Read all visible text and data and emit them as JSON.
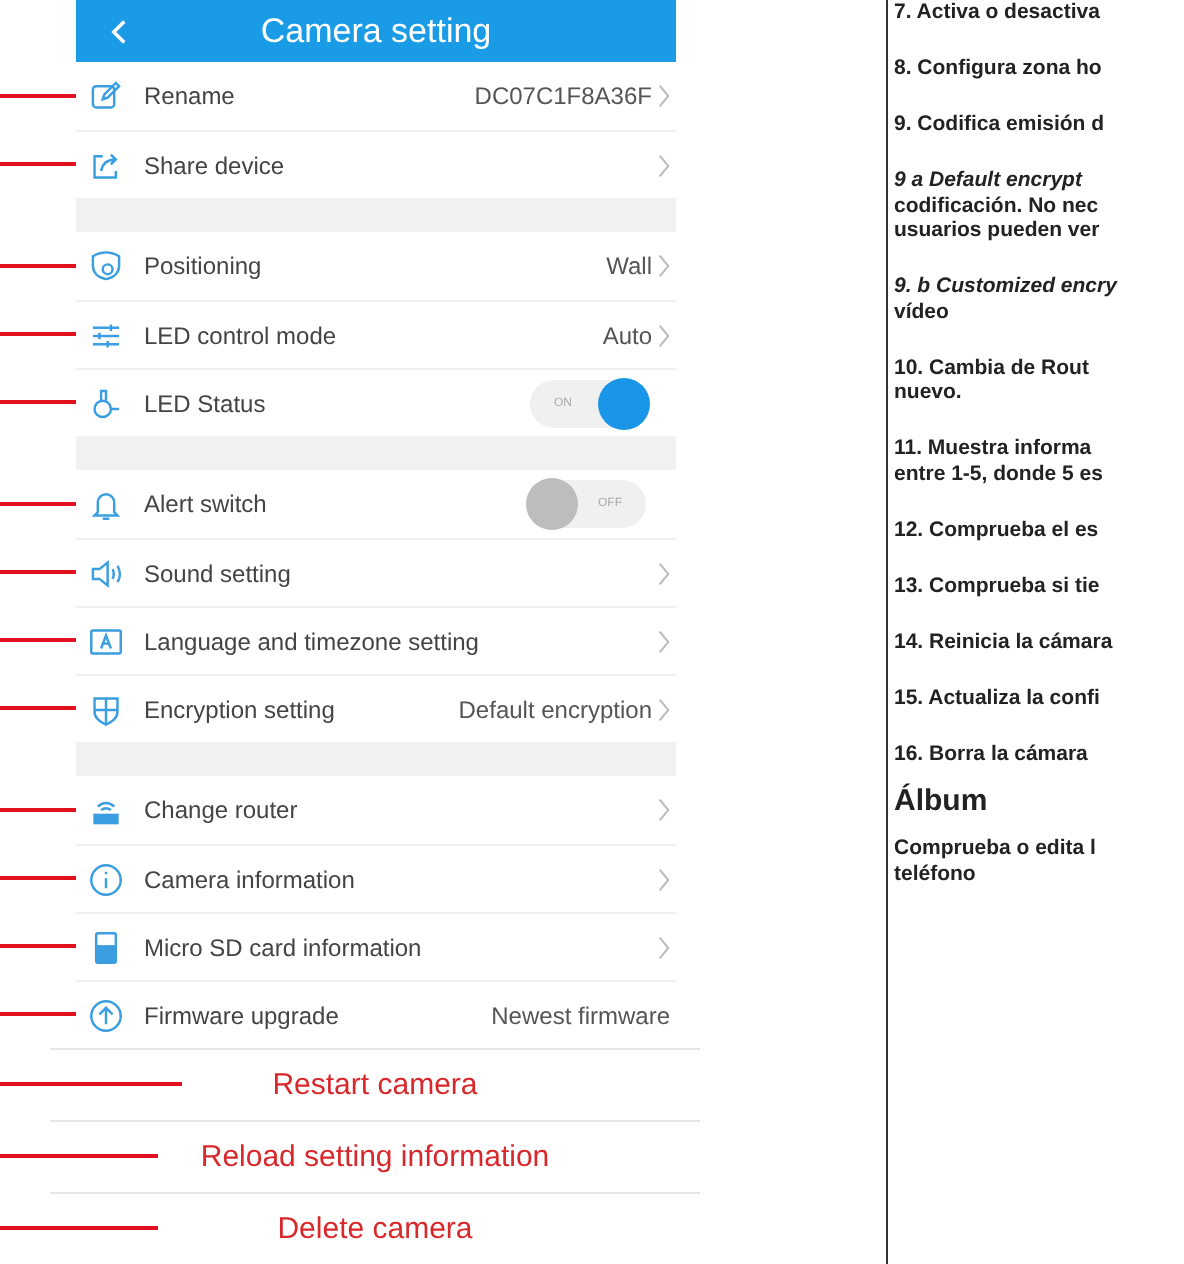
{
  "header": {
    "title": "Camera setting"
  },
  "groups": [
    [
      {
        "kind": "link",
        "label": "Rename",
        "value": "DC07C1F8A36F"
      },
      {
        "kind": "link",
        "label": "Share device"
      }
    ],
    [
      {
        "kind": "link",
        "label": "Positioning",
        "value": "Wall"
      },
      {
        "kind": "link",
        "label": "LED control mode",
        "value": "Auto"
      },
      {
        "kind": "toggle",
        "label": "LED Status",
        "on": true,
        "state_text": "ON"
      }
    ],
    [
      {
        "kind": "toggle",
        "label": "Alert switch",
        "on": false,
        "state_text": "OFF"
      },
      {
        "kind": "link",
        "label": "Sound setting"
      },
      {
        "kind": "link",
        "label": "Language and timezone setting"
      },
      {
        "kind": "link",
        "label": "Encryption setting",
        "value": "Default encryption"
      }
    ],
    [
      {
        "kind": "link",
        "label": "Change router"
      },
      {
        "kind": "link",
        "label": "Camera information"
      },
      {
        "kind": "link",
        "label": "Micro SD card information"
      },
      {
        "kind": "info",
        "label": "Firmware upgrade",
        "value": "Newest firmware"
      }
    ]
  ],
  "actions": [
    {
      "label": "Restart camera"
    },
    {
      "label": "Reload setting information"
    },
    {
      "label": "Delete camera"
    }
  ],
  "manual": [
    {
      "kind": "paragraph",
      "lines": [
        "7. Activa o desactiva"
      ]
    },
    {
      "kind": "paragraph",
      "lines": [
        "8. Configura zona ho"
      ]
    },
    {
      "kind": "paragraph",
      "lines": [
        "9. Codifica emisión d"
      ]
    },
    {
      "kind": "paragraph",
      "lines": [
        "*9 a  Default encrypt*",
        "codificación. No nec",
        "usuarios pueden ver"
      ]
    },
    {
      "kind": "paragraph",
      "lines": [
        "*9. b Customized encry*",
        "vídeo"
      ]
    },
    {
      "kind": "paragraph",
      "lines": [
        "10. Cambia de Rout",
        "nuevo."
      ]
    },
    {
      "kind": "paragraph",
      "lines": [
        "11. Muestra informa",
        "entre 1-5, donde 5 es"
      ]
    },
    {
      "kind": "paragraph",
      "lines": [
        "12. Comprueba el es"
      ]
    },
    {
      "kind": "paragraph",
      "lines": [
        "13. Comprueba si tie"
      ]
    },
    {
      "kind": "paragraph",
      "lines": [
        "14. Reinicia la cámara"
      ]
    },
    {
      "kind": "paragraph",
      "lines": [
        "15. Actualiza la confi"
      ]
    },
    {
      "kind": "paragraph",
      "lines": [
        "16. Borra la cámara"
      ]
    },
    {
      "kind": "heading",
      "text": "Álbum"
    },
    {
      "kind": "paragraph",
      "lines": [
        "Comprueba o edita l",
        "teléfono"
      ]
    }
  ]
}
